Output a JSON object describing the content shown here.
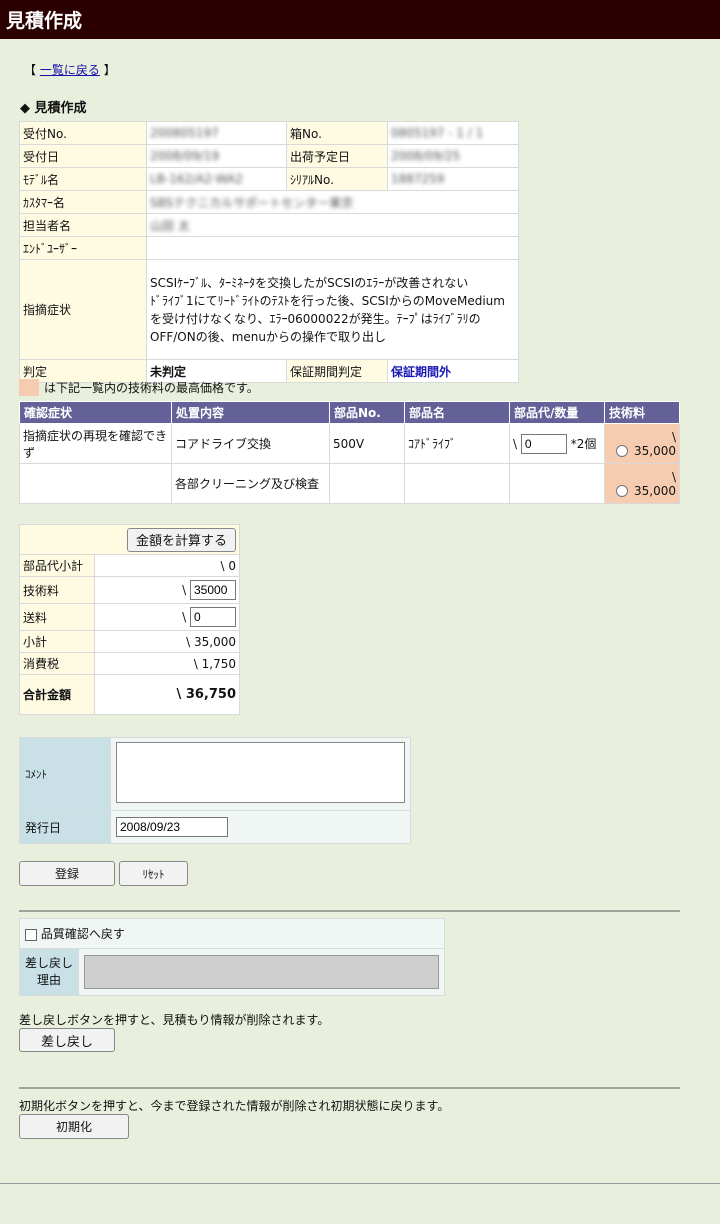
{
  "page": {
    "title": "見積作成",
    "back_link": "一覧に戻る",
    "back_open": "【",
    "back_close": "】",
    "section_title": "見積作成",
    "section_marker": "◆"
  },
  "info": {
    "reception_no_label": "受付No.",
    "reception_no": "200805197",
    "box_no_label": "箱No.",
    "box_no": "0805197 - 1 / 1",
    "reception_date_label": "受付日",
    "reception_date": "2008/09/19",
    "ship_date_label": "出荷予定日",
    "ship_date": "2008/09/25",
    "model_label": "ﾓﾃﾞﾙ名",
    "model": "LB-162/A2-WA2",
    "serial_label": "ｼﾘｱﾙNo.",
    "serial": "1887259",
    "customer_label": "ｶｽﾀﾏｰ名",
    "customer": "SBSテクニカルサポートセンター東京",
    "staff_label": "担当者名",
    "staff": "山田 太",
    "end_user_label": "ｴﾝﾄﾞﾕｰｻﾞｰ",
    "end_user": "",
    "symptom_label": "指摘症状",
    "symptom_lines": [
      "SCSIｹｰﾌﾞﾙ、ﾀｰﾐﾈｰﾀを交換したがSCSIのｴﾗｰが改善されない",
      "ﾄﾞﾗｲﾌﾞ1にてﾘｰﾄﾞﾗｲﾄのﾃｽﾄを行った後、SCSIからのMoveMedium",
      "を受け付けなくなり、ｴﾗｰ06000022が発生。ﾃｰﾌﾟはﾗｲﾌﾞﾗﾘの",
      "OFF/ONの後、menuからの操作で取り出し"
    ],
    "judgment_label": "判定",
    "judgment": "未判定",
    "warranty_label": "保証期間判定",
    "warranty": "保証期間外"
  },
  "legend_text": "は下記一覧内の技術料の最高価格です。",
  "repair_table": {
    "headers": [
      "確認症状",
      "処置内容",
      "部品No.",
      "部品名",
      "部品代/数量",
      "技術料"
    ],
    "rows": [
      {
        "symptom": "指摘症状の再現を確認できず",
        "action": "コアドライブ交換",
        "part_no": "500V",
        "part_name": "ｺｱﾄﾞﾗｲﾌﾞ",
        "currency": "\\",
        "price": "0",
        "qty": "*2個",
        "fee_currency": "\\",
        "fee": "35,000"
      },
      {
        "symptom": "",
        "action": "各部クリーニング及び検査",
        "part_no": "",
        "part_name": "",
        "currency": "",
        "price": "",
        "qty": "",
        "fee_currency": "\\",
        "fee": "35,000"
      }
    ]
  },
  "totals": {
    "calc_button": "金額を計算する",
    "parts_subtotal_label": "部品代小計",
    "parts_subtotal": "\\ 0",
    "tech_fee_label": "技術料",
    "tech_fee_currency": "\\",
    "tech_fee": "35000",
    "shipping_label": "送料",
    "shipping_currency": "\\",
    "shipping": "0",
    "subtotal_label": "小計",
    "subtotal": "\\ 35,000",
    "tax_label": "消費税",
    "tax": "\\ 1,750",
    "total_label": "合計金額",
    "total": "\\ 36,750"
  },
  "comment": {
    "comment_label": "ｺﾒﾝﾄ",
    "comment_value": "",
    "issue_date_label": "発行日",
    "issue_date": "2008/09/23"
  },
  "buttons": {
    "register": "登録",
    "reset": "ﾘｾｯﾄ"
  },
  "quality": {
    "checkbox_label": "品質確認へ戻す",
    "reason_label_1": "差し戻し",
    "reason_label_2": "理由"
  },
  "sendback": {
    "note": "差し戻しボタンを押すと、見積もり情報が削除されます。",
    "button": "差し戻し"
  },
  "init": {
    "note": "初期化ボタンを押すと、今まで登録された情報が削除され初期状態に戻ります。",
    "button": "初期化"
  }
}
